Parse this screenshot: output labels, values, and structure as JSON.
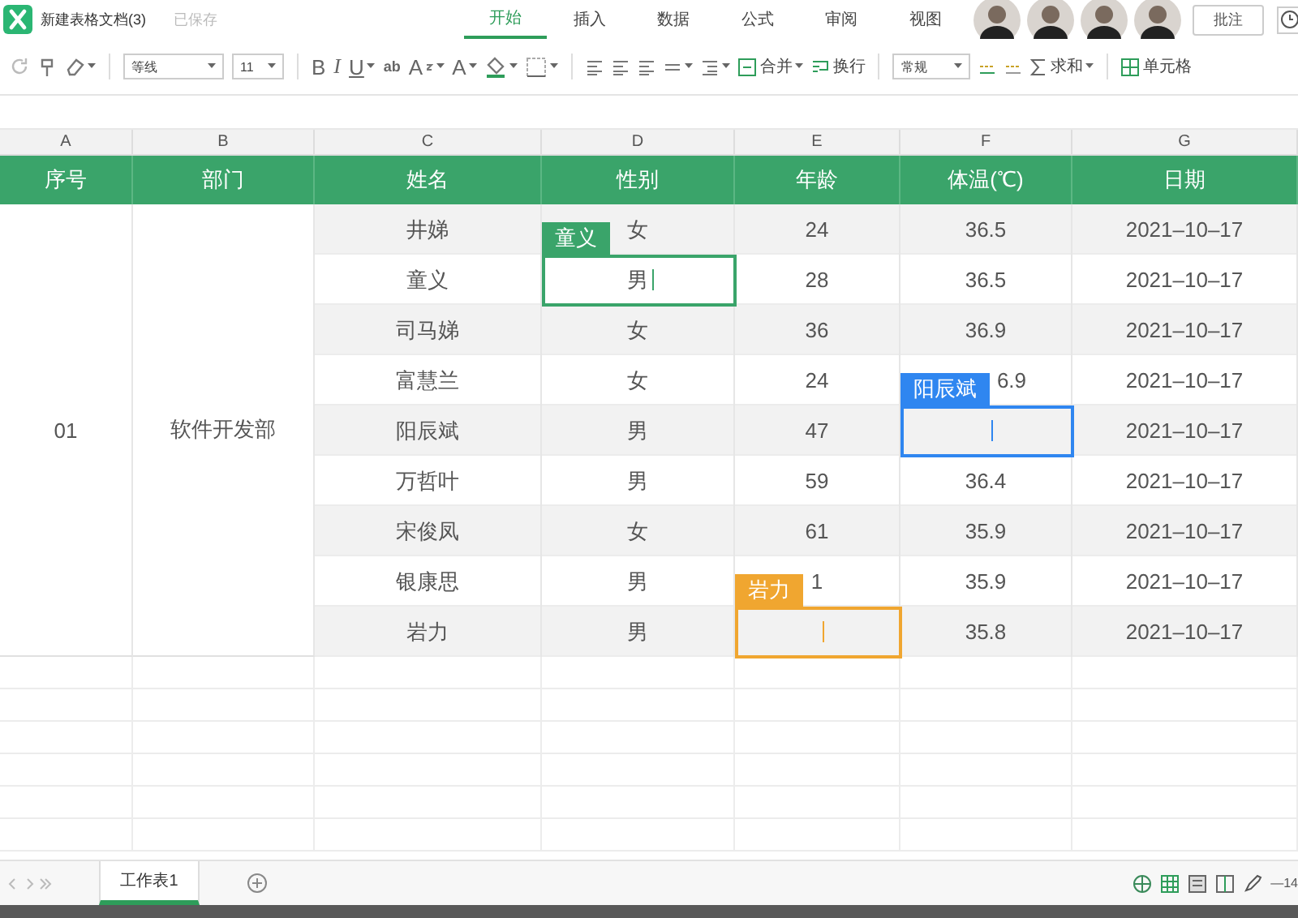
{
  "app": {
    "title": "新建表格文档(3)",
    "save_status": "已保存"
  },
  "menu_tabs": [
    {
      "label": "开始",
      "selected": true
    },
    {
      "label": "插入",
      "selected": false
    },
    {
      "label": "数据",
      "selected": false
    },
    {
      "label": "公式",
      "selected": false
    },
    {
      "label": "审阅",
      "selected": false
    },
    {
      "label": "视图",
      "selected": false
    }
  ],
  "collaborators": [
    {
      "kind": "avatar"
    },
    {
      "kind": "avatar"
    },
    {
      "kind": "avatar"
    },
    {
      "kind": "avatar"
    }
  ],
  "comment_button": "批注",
  "toolbar": {
    "font": "等线",
    "font_size": "11",
    "bold": "B",
    "italic": "I",
    "underline": "U",
    "strikethrough": "ab",
    "superscript": "A",
    "font_color": "A",
    "merge": "合并",
    "wrap": "换行",
    "number_format": "常规",
    "sum": "求和",
    "cell": "单元格"
  },
  "sheet": {
    "columns": [
      "A",
      "B",
      "C",
      "D",
      "E",
      "F",
      "G"
    ],
    "headers": [
      "序号",
      "部门",
      "姓名",
      "性别",
      "年龄",
      "体温(℃)",
      "日期"
    ],
    "rows": [
      {
        "shaded": true,
        "cells": [
          "",
          "",
          "井娣",
          "女",
          "24",
          "36.5",
          "2021–10–17"
        ]
      },
      {
        "shaded": false,
        "cells": [
          "",
          "",
          "童义",
          {
            "text": "男",
            "editing": true
          },
          "28",
          "36.5",
          "2021–10–17"
        ]
      },
      {
        "shaded": true,
        "cells": [
          "",
          "",
          "司马娣",
          "女",
          "36",
          "36.9",
          "2021–10–17"
        ]
      },
      {
        "shaded": false,
        "cells": [
          "",
          "",
          "富慧兰",
          "女",
          "24",
          "6.9",
          "2021–10–17"
        ]
      },
      {
        "shaded": true,
        "cells": [
          "01",
          "软件开发部",
          "阳辰斌",
          "男",
          "47",
          {
            "text": "",
            "editing": true
          },
          "2021–10–17"
        ]
      },
      {
        "shaded": false,
        "cells": [
          "",
          "",
          "万哲叶",
          "男",
          "59",
          "36.4",
          "2021–10–17"
        ]
      },
      {
        "shaded": true,
        "cells": [
          "",
          "",
          "宋俊凤",
          "女",
          "61",
          "35.9",
          "2021–10–17"
        ]
      },
      {
        "shaded": false,
        "cells": [
          "",
          "",
          "银康思",
          "男",
          "1",
          "35.9",
          "2021–10–17"
        ]
      },
      {
        "shaded": true,
        "cells": [
          "",
          "",
          "岩力",
          "男",
          {
            "text": "",
            "editing": true
          },
          "35.8",
          "2021–10–17"
        ]
      }
    ],
    "editors": [
      {
        "name": "童义",
        "color": "#3aa46a"
      },
      {
        "name": "阳辰斌",
        "color": "#2f86f0"
      },
      {
        "name": "岩力",
        "color": "#f0a630"
      }
    ]
  },
  "sheet_tabs": [
    {
      "label": "工作表1",
      "selected": true
    }
  ],
  "zoom_text": "—14"
}
